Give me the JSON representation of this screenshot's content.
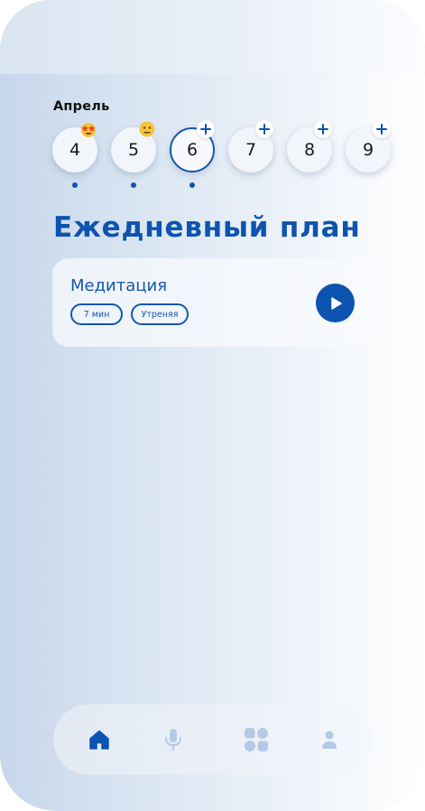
{
  "calendar": {
    "month": "Апрель",
    "days": [
      {
        "label": "4",
        "badge": "star-struck-emoji-icon",
        "has_dot": true,
        "selected": false
      },
      {
        "label": "5",
        "badge": "neutral-face-emoji-icon",
        "has_dot": true,
        "selected": false
      },
      {
        "label": "6",
        "badge": "plus-icon",
        "has_dot": true,
        "selected": true
      },
      {
        "label": "7",
        "badge": "plus-icon",
        "has_dot": false,
        "selected": false
      },
      {
        "label": "8",
        "badge": "plus-icon",
        "has_dot": false,
        "selected": false
      },
      {
        "label": "9",
        "badge": "plus-icon",
        "has_dot": false,
        "selected": false
      }
    ]
  },
  "daily_plan": {
    "title": "Ежедневный план",
    "items": [
      {
        "title": "Медитация",
        "tags": [
          "7 мин",
          "Утреняя"
        ],
        "action_icon": "play-icon"
      }
    ]
  },
  "nav": {
    "items": [
      {
        "icon": "home-icon",
        "active": true
      },
      {
        "icon": "microphone-icon",
        "active": false
      },
      {
        "icon": "grid-icon",
        "active": false
      },
      {
        "icon": "profile-icon",
        "active": false
      }
    ]
  },
  "colors": {
    "accent": "#0d54b0",
    "inactive_icon": "#b4c9e5",
    "card_bg": "#f3f6fb"
  }
}
